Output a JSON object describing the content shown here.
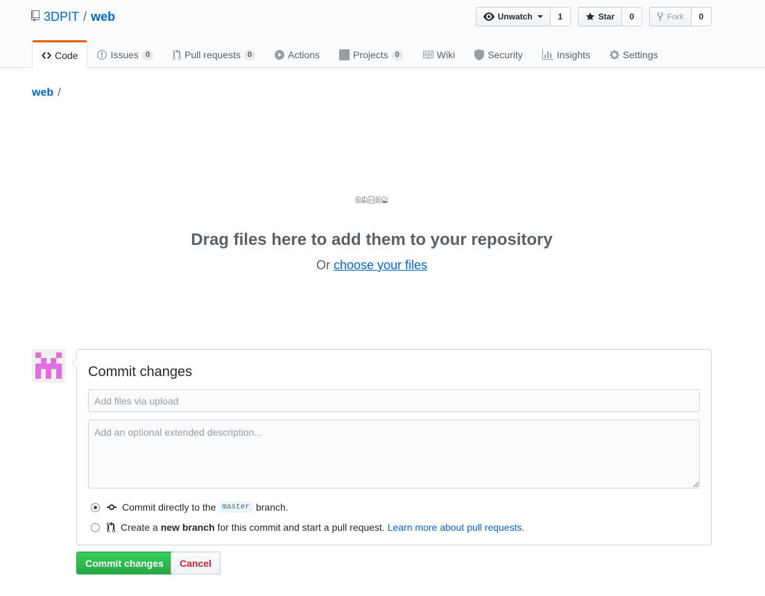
{
  "repo": {
    "owner": "3DPIT",
    "separator": "/",
    "name": "web"
  },
  "actions": {
    "watch": {
      "label": "Unwatch",
      "count": "1"
    },
    "star": {
      "label": "Star",
      "count": "0"
    },
    "fork": {
      "label": "Fork",
      "count": "0"
    }
  },
  "tabs": [
    {
      "label": "Code",
      "icon": "code-icon",
      "selected": true
    },
    {
      "label": "Issues",
      "icon": "issue-icon",
      "counter": "0"
    },
    {
      "label": "Pull requests",
      "icon": "pull-request-icon",
      "counter": "0"
    },
    {
      "label": "Actions",
      "icon": "play-icon"
    },
    {
      "label": "Projects",
      "icon": "project-icon",
      "counter": "0"
    },
    {
      "label": "Wiki",
      "icon": "book-icon"
    },
    {
      "label": "Security",
      "icon": "shield-icon"
    },
    {
      "label": "Insights",
      "icon": "graph-icon"
    },
    {
      "label": "Settings",
      "icon": "gear-icon"
    }
  ],
  "breadcrumb": {
    "root": "web",
    "separator": "/"
  },
  "dropzone": {
    "title": "Drag files here to add them to your repository",
    "sub_prefix": "Or",
    "sub_link": "choose your files"
  },
  "commit": {
    "title": "Commit changes",
    "summary_placeholder": "Add files via upload",
    "description_placeholder": "Add an optional extended description...",
    "option_direct": {
      "prefix": "Commit directly to the",
      "branch": "master",
      "suffix": "branch.",
      "checked": true
    },
    "option_branch": {
      "prefix": "Create a",
      "bold": "new branch",
      "suffix": "for this commit and start a pull request.",
      "link": "Learn more about pull requests."
    },
    "submit_label": "Commit changes",
    "cancel_label": "Cancel"
  },
  "colors": {
    "link": "#0366d6",
    "selected_tab_accent": "#e36209",
    "primary_button": "#28a745",
    "danger_text": "#cb2431",
    "avatar_pink": "#e26de2"
  }
}
